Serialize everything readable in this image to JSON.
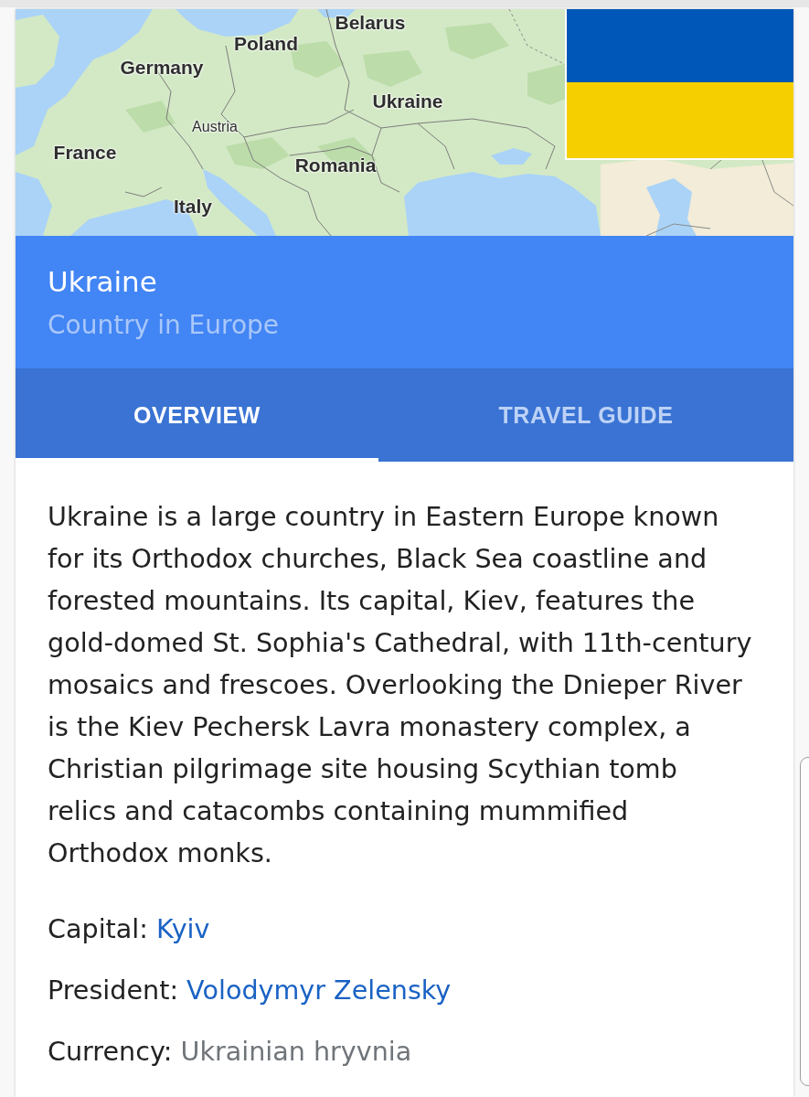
{
  "map": {
    "labels": [
      "Belarus",
      "Poland",
      "Germany",
      "Ukraine",
      "Austria",
      "France",
      "Romania",
      "Italy"
    ]
  },
  "header": {
    "title": "Ukraine",
    "subtitle": "Country in Europe"
  },
  "tabs": [
    {
      "label": "OVERVIEW",
      "selected": true
    },
    {
      "label": "TRAVEL GUIDE",
      "selected": false
    }
  ],
  "description": "Ukraine is a large country in Eastern Europe known for its Orthodox churches, Black Sea coastline and forested mountains. Its capital, Kiev, features the gold-domed St. Sophia's Cathedral, with 11th-century mosaics and frescoes. Overlooking the Dnieper River is the Kiev Pechersk Lavra monastery complex, a Christian pilgrimage site housing Scythian tomb relics and catacombs containing mummified Orthodox monks.",
  "facts": [
    {
      "label": "Capital:",
      "value": "Kyiv",
      "kind": "link"
    },
    {
      "label": "President:",
      "value": "Volodymyr Zelensky",
      "kind": "link"
    },
    {
      "label": "Currency:",
      "value": "Ukrainian hryvnia",
      "kind": "text"
    }
  ]
}
